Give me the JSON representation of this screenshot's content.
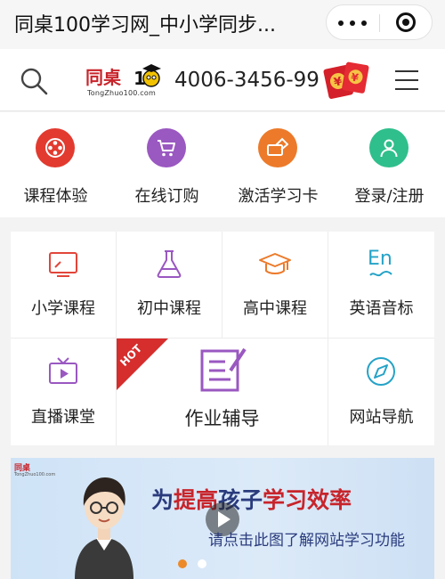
{
  "titlebar": {
    "title": "同桌100学习网_中小学同步..."
  },
  "header": {
    "logo_text": "同桌",
    "logo_domain": "TongZhuo100.com",
    "phone": "4006-3456-99"
  },
  "actions": [
    {
      "label": "课程体验",
      "color": "#e23a2f",
      "icon": "film-reel-icon"
    },
    {
      "label": "在线订购",
      "color": "#9a58c1",
      "icon": "shopping-cart-icon"
    },
    {
      "label": "激活学习卡",
      "color": "#ec7a2a",
      "icon": "card-icon"
    },
    {
      "label": "登录/注册",
      "color": "#2fbf8c",
      "icon": "user-icon"
    }
  ],
  "grid": {
    "primary": "小学课程",
    "junior": "初中课程",
    "senior": "高中课程",
    "phonetics": "英语音标",
    "live": "直播课堂",
    "homework": "作业辅导",
    "navigation": "网站导航",
    "hot_badge": "HOT",
    "phonetics_icon_text": "En"
  },
  "banner": {
    "logo_text": "同桌",
    "logo_domain": "TongZhuo100.com",
    "slogan_1": "为",
    "slogan_2": "提高",
    "slogan_3": "孩子",
    "slogan_4": "学习效率",
    "subtitle": "请点击此图了解网站学习功能",
    "active_slide": 1,
    "slide_count": 2
  },
  "colors": {
    "brand_red": "#c8242b",
    "accent_orange": "#ec7a2a",
    "accent_purple": "#9a58c1",
    "accent_teal": "#25a3c7"
  }
}
